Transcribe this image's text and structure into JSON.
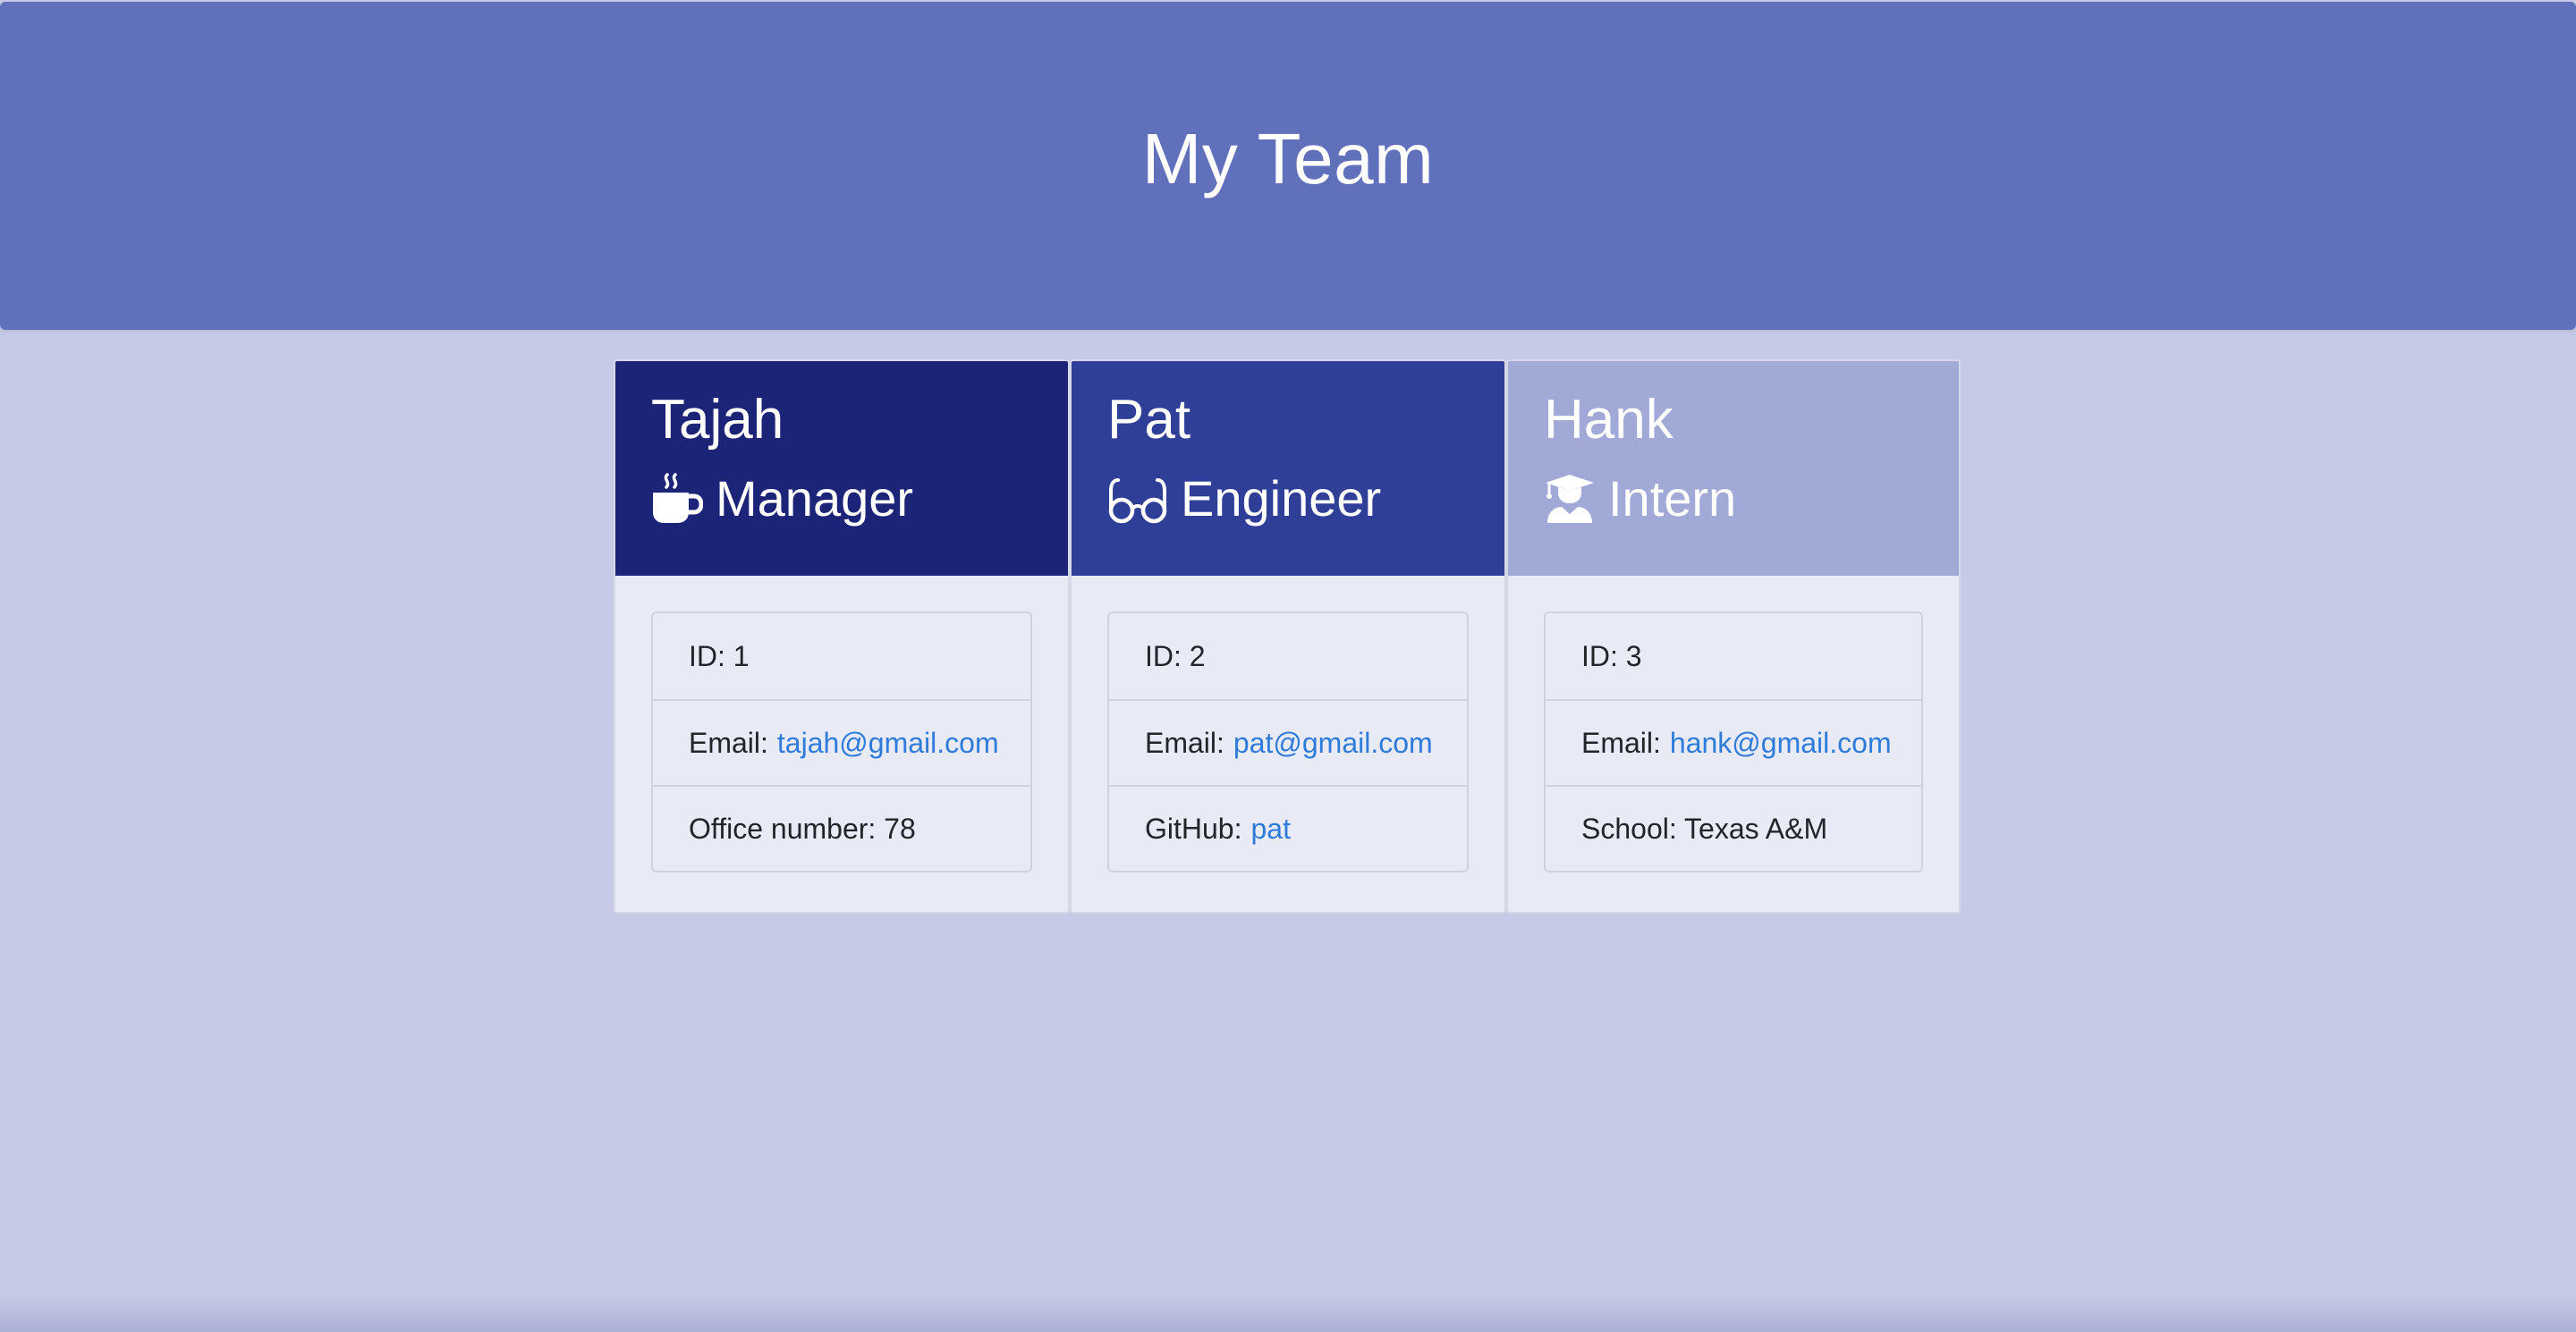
{
  "header": {
    "title": "My Team"
  },
  "team": [
    {
      "name": "Tajah",
      "role": "Manager",
      "icon": "coffee-icon",
      "id_text": "ID: 1",
      "email_label": "Email:",
      "email": "tajah@gmail.com",
      "extra_label": "Office number: 78",
      "extra_link": ""
    },
    {
      "name": "Pat",
      "role": "Engineer",
      "icon": "glasses-icon",
      "id_text": "ID: 2",
      "email_label": "Email:",
      "email": "pat@gmail.com",
      "extra_label": "GitHub:",
      "extra_link": "pat"
    },
    {
      "name": "Hank",
      "role": "Intern",
      "icon": "graduate-icon",
      "id_text": "ID: 3",
      "email_label": "Email:",
      "email": "hank@gmail.com",
      "extra_label": "School: Texas A&M",
      "extra_link": ""
    }
  ],
  "colors": {
    "header_bg": "#6070bb",
    "page_bg": "#c6cae6",
    "manager": "#1b2477",
    "engineer": "#2f3f97",
    "intern": "#a1a9d7",
    "link": "#2f7bd9"
  }
}
